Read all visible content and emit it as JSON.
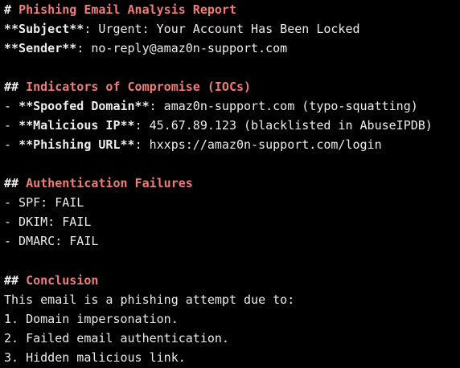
{
  "report": {
    "title_marker": "# ",
    "title": "Phishing Email Analysis Report",
    "subject_key": "**Subject**",
    "subject_value": ": Urgent: Your Account Has Been Locked",
    "sender_key": "**Sender**",
    "sender_value": ": no-reply@amaz0n-support.com"
  },
  "sections": {
    "ioc": {
      "marker": "## ",
      "heading": "Indicators of Compromise (IOCs)",
      "items": [
        {
          "prefix": "- ",
          "key": "**Spoofed Domain**",
          "value": ": amaz0n-support.com (typo-squatting)"
        },
        {
          "prefix": "- ",
          "key": "**Malicious IP**",
          "value": ": 45.67.89.123 (blacklisted in AbuseIPDB)"
        },
        {
          "prefix": "- ",
          "key": "**Phishing URL**",
          "value": ": hxxps://amaz0n-support.com/login"
        }
      ]
    },
    "auth": {
      "marker": "## ",
      "heading": "Authentication Failures",
      "items": [
        "- SPF: FAIL",
        "- DKIM: FAIL",
        "- DMARC: FAIL"
      ]
    },
    "conclusion": {
      "marker": "## ",
      "heading": "Conclusion",
      "intro": "This email is a phishing attempt due to:",
      "items": [
        "1. Domain impersonation.",
        "2. Failed email authentication.",
        "3. Hidden malicious link."
      ]
    }
  },
  "colors": {
    "background": "#000000",
    "text": "#ececec",
    "heading": "#f07b78"
  }
}
